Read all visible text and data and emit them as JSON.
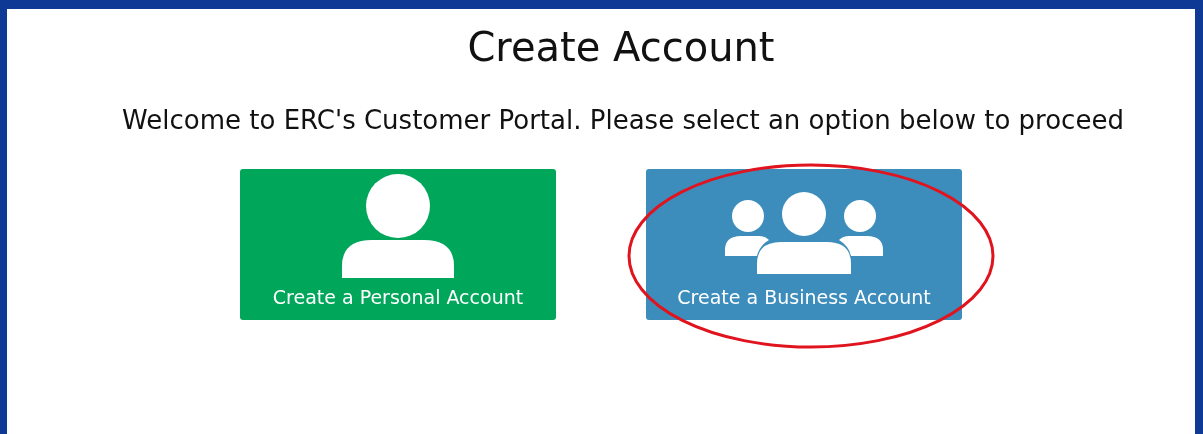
{
  "title": "Create Account",
  "subtitle": "Welcome to ERC's Customer Portal. Please select an option below to proceed",
  "options": [
    {
      "kind": "personal",
      "label": "Create a Personal Account",
      "color": "#00a65a",
      "highlighted": false
    },
    {
      "kind": "business",
      "label": "Create a Business Account",
      "color": "#3c8dbc",
      "highlighted": true
    }
  ]
}
